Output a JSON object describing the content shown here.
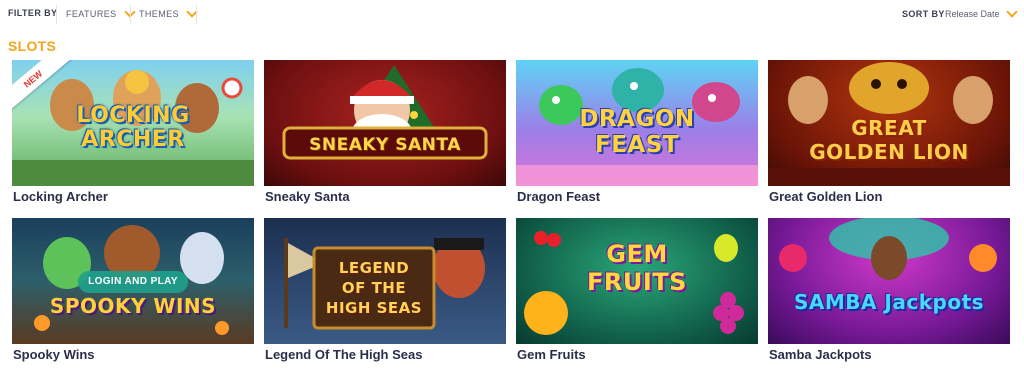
{
  "filters": {
    "filter_by_label": "FILTER BY",
    "features_label": "FEATURES",
    "themes_label": "THEMES",
    "sort_by_label": "SORT BY",
    "sort_value": "Release Date"
  },
  "section": {
    "title": "SLOTS"
  },
  "accent_color": "#f4a51c",
  "games": [
    {
      "title": "Locking Archer",
      "logo": "LOCKING\nARCHER",
      "badge": "NEW"
    },
    {
      "title": "Sneaky Santa",
      "logo": "SNEAKY SANTA"
    },
    {
      "title": "Dragon Feast",
      "logo": "DRAGON\nFEAST"
    },
    {
      "title": "Great Golden Lion",
      "logo": "GREAT\nGOLDEN LION"
    },
    {
      "title": "Spooky Wins",
      "logo": "SPOOKY WINS",
      "overlay_button": "LOGIN AND PLAY"
    },
    {
      "title": "Legend Of The High Seas",
      "logo": "LEGEND\nOF THE\nHIGH SEAS"
    },
    {
      "title": "Gem Fruits",
      "logo": "GEM\nFRUITS"
    },
    {
      "title": "Samba Jackpots",
      "logo": "SAMBA Jackpots"
    }
  ]
}
